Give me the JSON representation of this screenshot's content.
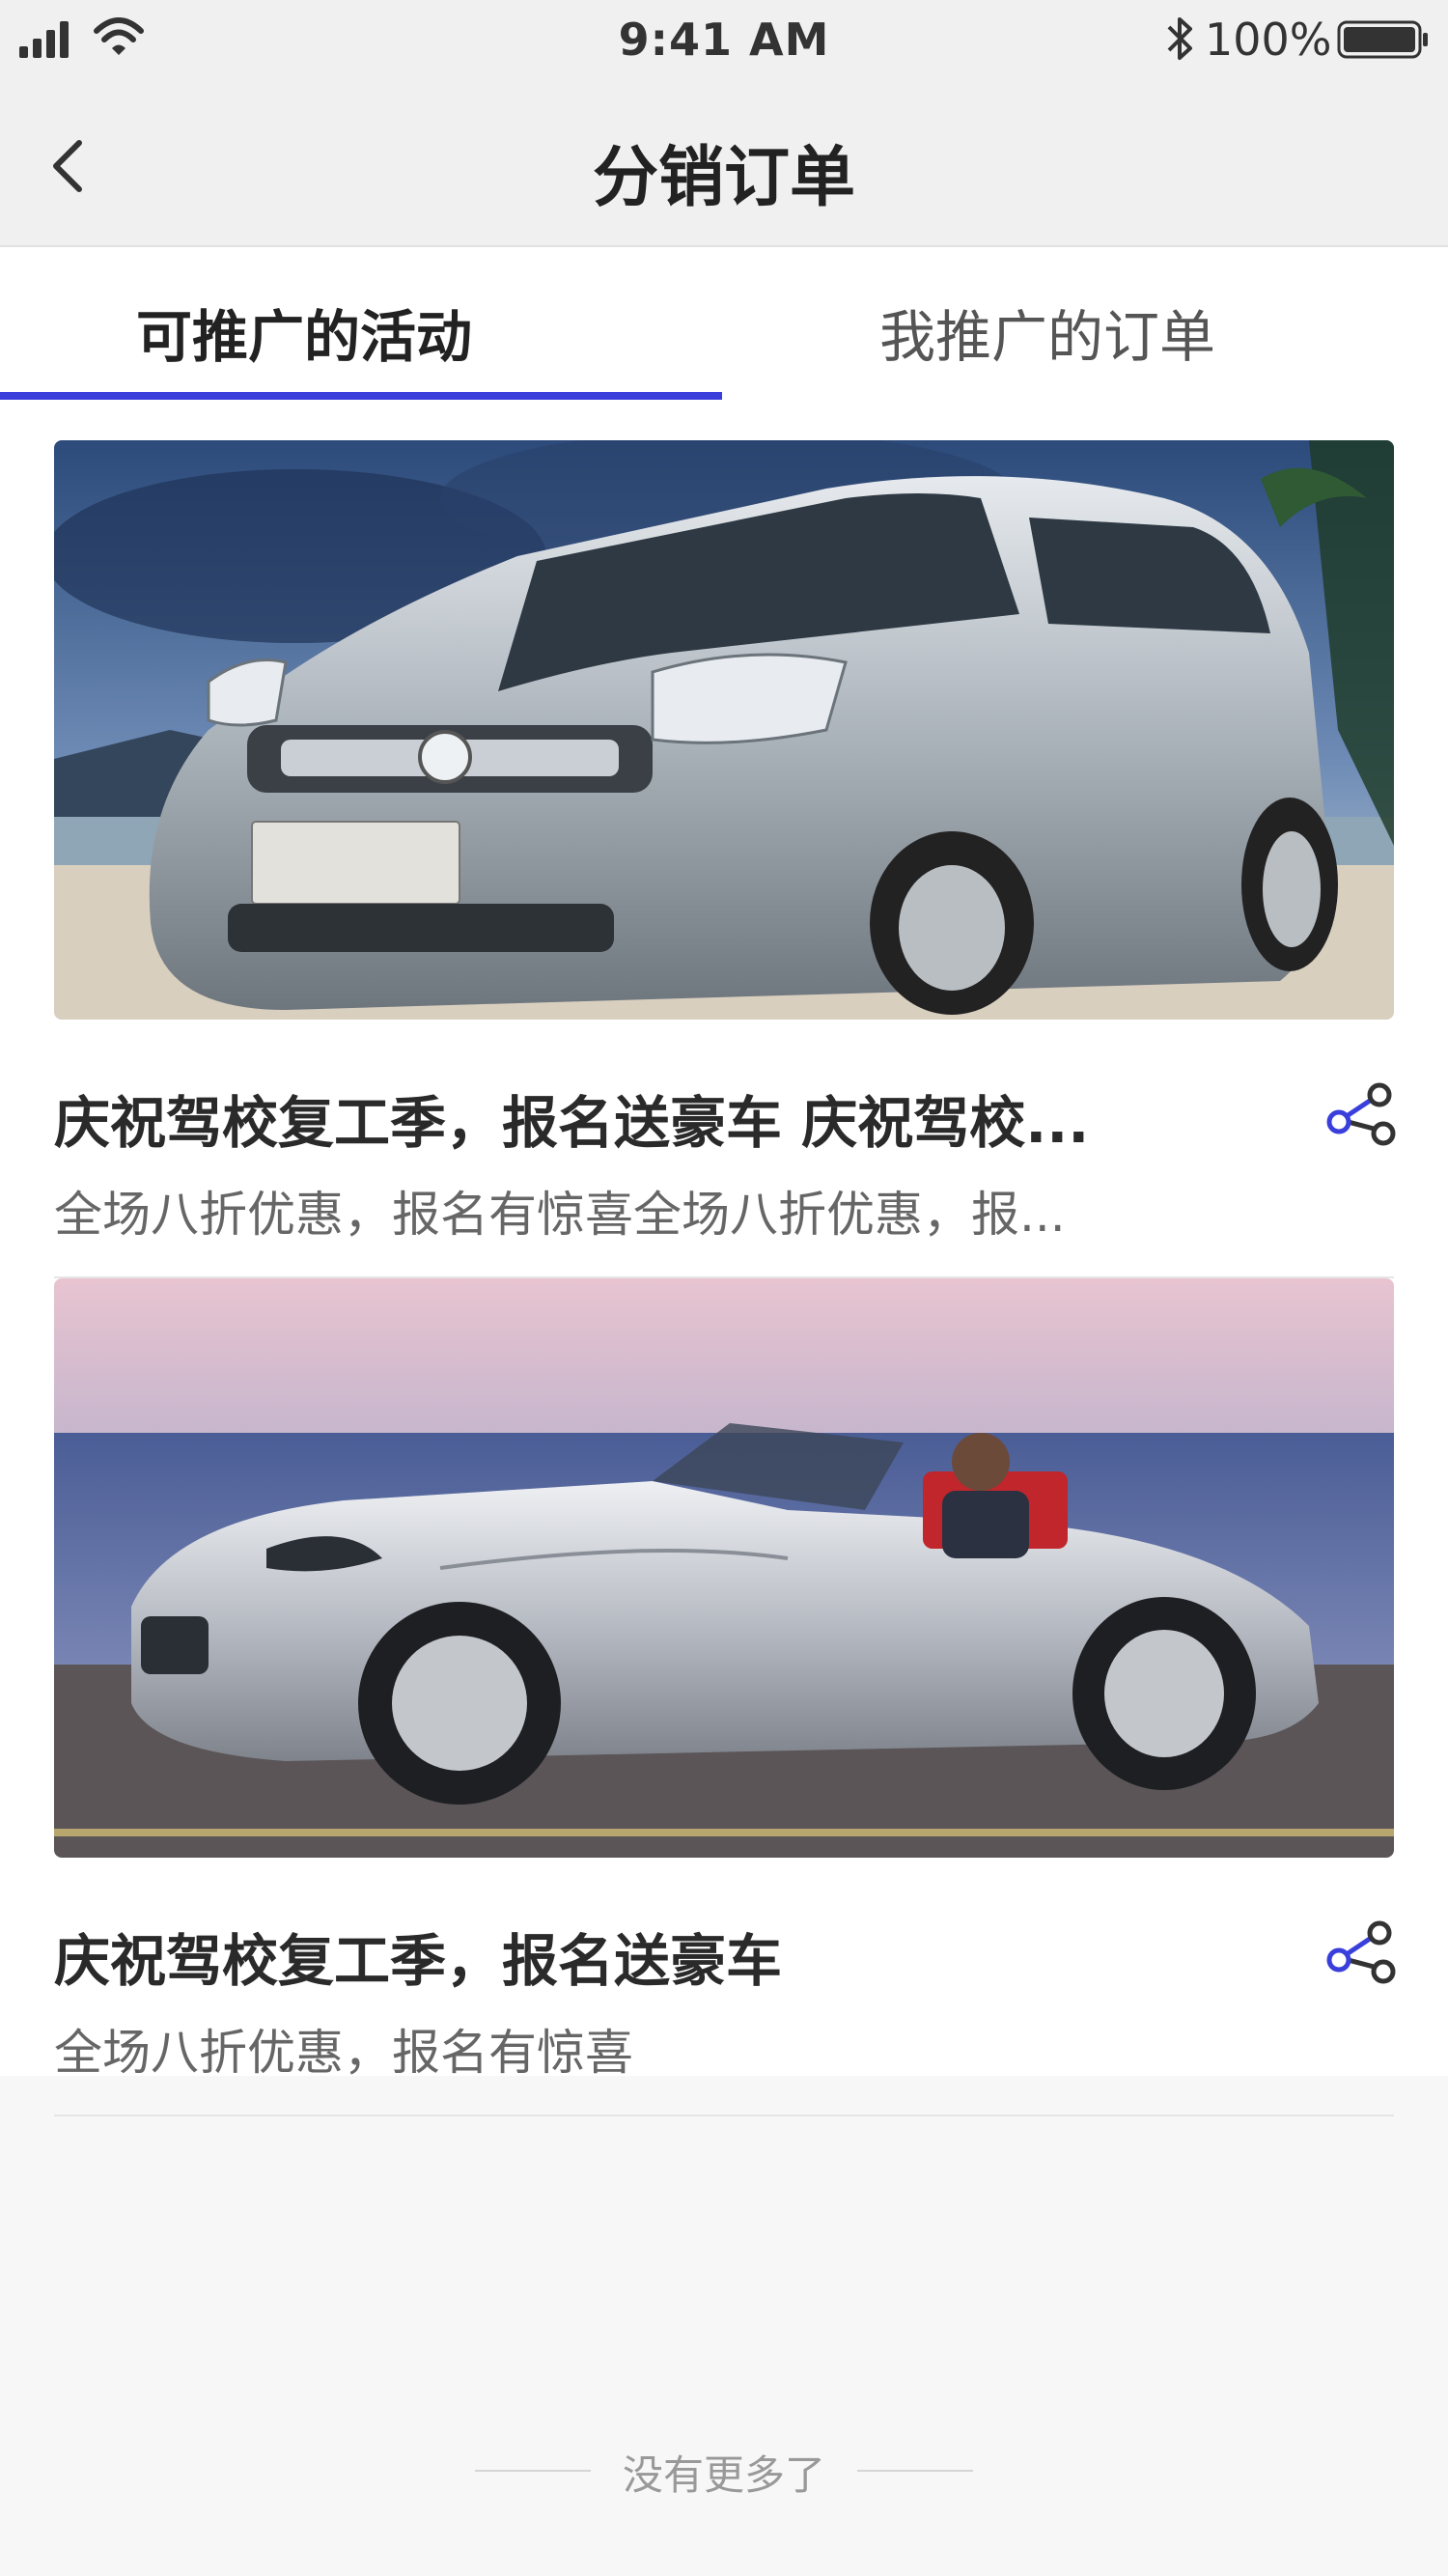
{
  "status_bar": {
    "time": "9:41 AM",
    "battery_percent": "100%",
    "signal_icon": "signal-icon",
    "wifi_icon": "wifi-icon",
    "bluetooth_icon": "bluetooth-icon",
    "battery_icon": "battery-icon"
  },
  "nav": {
    "title": "分销订单",
    "back_icon": "chevron-left-icon"
  },
  "tabs": [
    {
      "label": "可推广的活动",
      "active": true
    },
    {
      "label": "我推广的订单",
      "active": false
    }
  ],
  "accent_color": "#3a3fdc",
  "cards": [
    {
      "title": "庆祝驾校复工季，报名送豪车 庆祝驾校...",
      "description": "全场八折优惠，报名有惊喜全场八折优惠，报...",
      "image": "silver-mpv-on-beach-photo",
      "share_icon": "share-icon"
    },
    {
      "title": "庆祝驾校复工季，报名送豪车",
      "description": "全场八折优惠，报名有惊喜",
      "image": "silver-convertible-by-sea-photo",
      "share_icon": "share-icon"
    }
  ],
  "footer": {
    "no_more_text": "没有更多了"
  }
}
